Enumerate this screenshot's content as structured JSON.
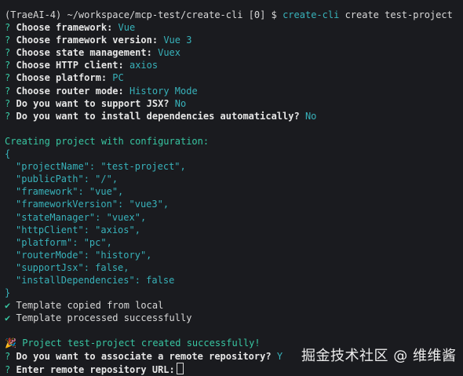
{
  "prompt": {
    "env": "(TraeAI-4)",
    "path": "~/workspace/mcp-test/create-cli",
    "exit": "[0]",
    "symbol": "$",
    "command": "create-cli",
    "args": "create test-project"
  },
  "questions": [
    {
      "label": "Choose framework:",
      "answer": "Vue"
    },
    {
      "label": "Choose framework version:",
      "answer": "Vue 3"
    },
    {
      "label": "Choose state management:",
      "answer": "Vuex"
    },
    {
      "label": "Choose HTTP client:",
      "answer": "axios"
    },
    {
      "label": "Choose platform:",
      "answer": "PC"
    },
    {
      "label": "Choose router mode:",
      "answer": "History Mode"
    },
    {
      "label": "Do you want to support JSX?",
      "answer": "No"
    },
    {
      "label": "Do you want to install dependencies automatically?",
      "answer": "No"
    }
  ],
  "qmark": "?",
  "creating": "Creating project with configuration:",
  "json_open": "{",
  "json_close": "}",
  "config": [
    "\"projectName\": \"test-project\",",
    "\"publicPath\": \"/\",",
    "\"framework\": \"vue\",",
    "\"frameworkVersion\": \"vue3\",",
    "\"stateManager\": \"vuex\",",
    "\"httpClient\": \"axios\",",
    "\"platform\": \"pc\",",
    "\"routerMode\": \"history\",",
    "\"supportJsx\": false,",
    "\"installDependencies\": false"
  ],
  "checkmark": "✔",
  "status": [
    "Template copied from local",
    "Template processed successfully"
  ],
  "success": {
    "emoji": "🎉",
    "text": "Project test-project created successfully!"
  },
  "remote_question": {
    "label": "Do you want to associate a remote repository?",
    "answer_tail": "Y"
  },
  "url_question": {
    "label": "Enter remote repository URL:"
  },
  "watermark": "掘金技术社区 @ 维维酱"
}
